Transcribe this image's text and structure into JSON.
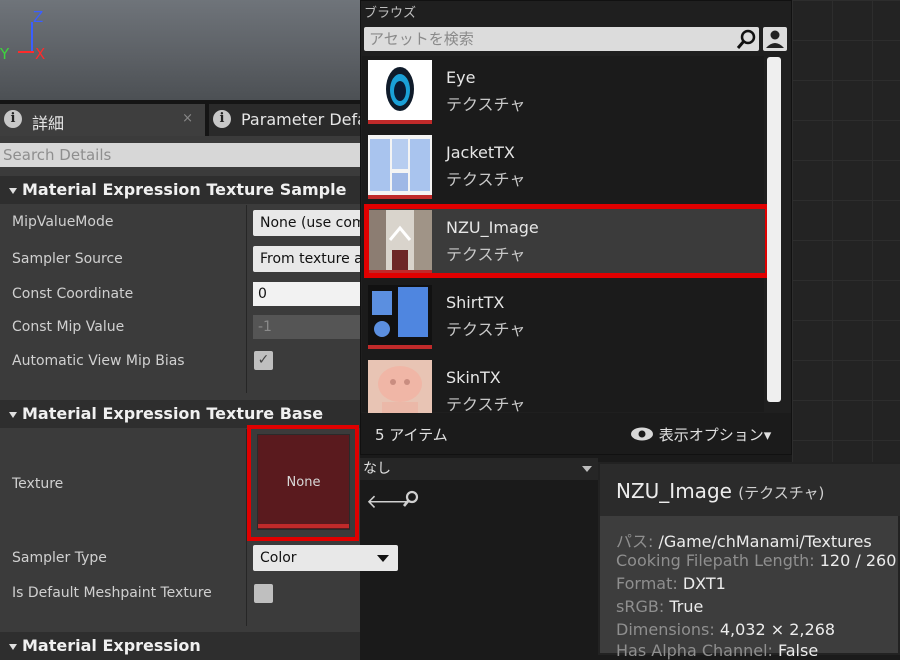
{
  "viewport": {
    "axis_z": "Z",
    "axis_x": "X",
    "axis_y": "Y"
  },
  "tabs": [
    {
      "label": "詳細",
      "close": "×"
    },
    {
      "label": "Parameter Defaults"
    }
  ],
  "details": {
    "search_placeholder": "Search Details",
    "sections": {
      "texture_sample": "Material Expression Texture Sample",
      "texture_base": "Material Expression Texture Base",
      "expression": "Material Expression"
    },
    "props": {
      "mip_value_mode": {
        "label": "MipValueMode",
        "value": "None (use computed mip level)"
      },
      "sampler_source": {
        "label": "Sampler Source",
        "value": "From texture asset"
      },
      "const_coordinate": {
        "label": "Const Coordinate",
        "value": "0"
      },
      "const_mip_value": {
        "label": "Const Mip Value",
        "value": "-1"
      },
      "auto_view_mip_bias": {
        "label": "Automatic View Mip Bias",
        "checked": "✓"
      },
      "texture": {
        "label": "Texture",
        "thumb_text": "None"
      },
      "sampler_type": {
        "label": "Sampler Type",
        "value": "Color"
      },
      "default_meshpaint": {
        "label": "Is Default Meshpaint Texture"
      }
    }
  },
  "browse": {
    "title": "ブラウズ",
    "search_placeholder": "アセットを検索",
    "assets": [
      {
        "name": "Eye",
        "type": "テクスチャ"
      },
      {
        "name": "JacketTX",
        "type": "テクスチャ"
      },
      {
        "name": "NZU_Image",
        "type": "テクスチャ"
      },
      {
        "name": "ShirtTX",
        "type": "テクスチャ"
      },
      {
        "name": "SkinTX",
        "type": "テクスチャ"
      }
    ],
    "item_count": "5 アイテム",
    "view_options": "表示オプション▾"
  },
  "texture_picker": {
    "current": "なし"
  },
  "tooltip": {
    "name": "NZU_Image",
    "type": "(テクスチャ)",
    "lines": [
      {
        "k": "パス: ",
        "v": "/Game/chManami/Textures"
      },
      {
        "k": "Cooking Filepath Length: ",
        "v": "120 / 260"
      },
      {
        "k": "Format: ",
        "v": "DXT1"
      },
      {
        "k": "sRGB: ",
        "v": "True"
      },
      {
        "k": "Dimensions: ",
        "v": "4,032 × 2,268"
      },
      {
        "k": "Has Alpha Channel: ",
        "v": "False"
      }
    ]
  },
  "colors": {
    "highlight": "#e00000",
    "accent_bar": "#c02a2a"
  }
}
